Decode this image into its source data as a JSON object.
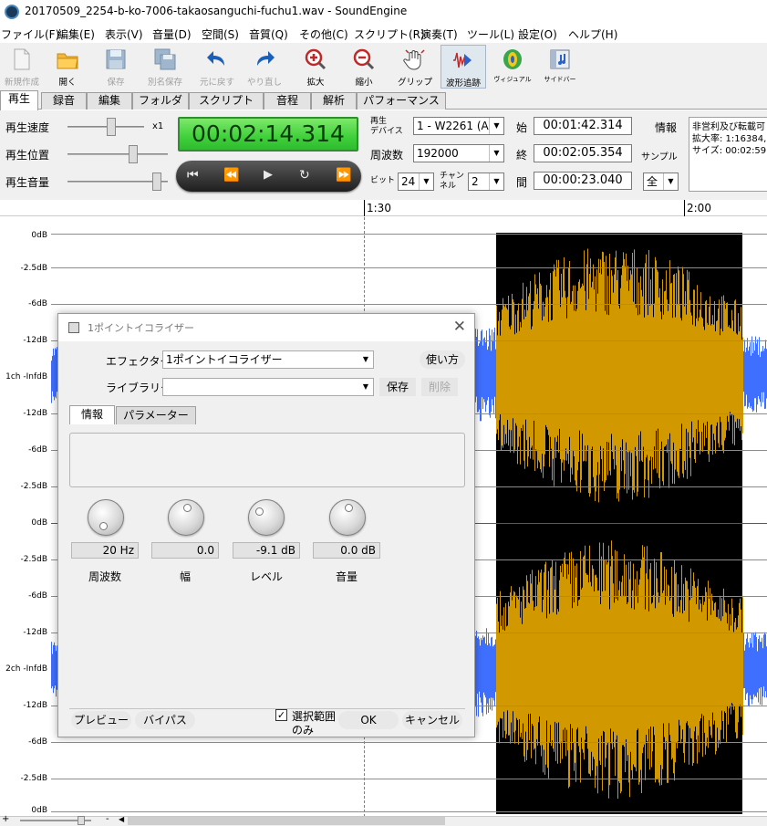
{
  "window": {
    "title": "20170509_2254-b-ko-7006-takaosanguchi-fuchu1.wav - SoundEngine"
  },
  "menu": [
    "ファイル(F)",
    "編集(E)",
    "表示(V)",
    "音量(D)",
    "空間(S)",
    "音質(Q)",
    "その他(C)",
    "スクリプト(R)",
    "演奏(T)",
    "ツール(L)",
    "設定(O)",
    "ヘルプ(H)"
  ],
  "toolbar": [
    {
      "label": "新規作成",
      "icon": "new-file-icon"
    },
    {
      "label": "開く",
      "icon": "folder-icon"
    },
    {
      "label": "保存",
      "icon": "save-icon"
    },
    {
      "label": "別名保存",
      "icon": "save-as-icon"
    },
    {
      "label": "元に戻す",
      "icon": "undo-icon"
    },
    {
      "label": "やり直し",
      "icon": "redo-icon"
    },
    {
      "label": "拡大",
      "icon": "zoom-in-icon"
    },
    {
      "label": "縮小",
      "icon": "zoom-out-icon"
    },
    {
      "label": "グリップ",
      "icon": "grip-hand-icon"
    },
    {
      "label": "波形追跡",
      "icon": "wave-track-icon"
    },
    {
      "label": "ヴィジュアル",
      "icon": "visual-icon"
    },
    {
      "label": "サイドバー",
      "icon": "sidebar-icon"
    }
  ],
  "tabs": [
    "再生",
    "録音",
    "編集",
    "フォルダ",
    "スクリプト",
    "音程",
    "解析",
    "パフォーマンス"
  ],
  "controls": {
    "speed_label": "再生速度",
    "position_label": "再生位置",
    "volume_label": "再生音量",
    "speed_multiplier": "x1",
    "time_display": "00:02:14.314",
    "device_label_1": "再生",
    "device_label_2": "デバイス",
    "device_value": "1 - W2261 (A",
    "freq_label": "周波数",
    "freq_value": "192000",
    "bit_label": "ビット",
    "bit_value": "24",
    "channel_label_1": "チャン",
    "channel_label_2": "ネル",
    "channel_value": "2",
    "start_label": "始",
    "start_value": "00:01:42.314",
    "end_label": "終",
    "end_value": "00:02:05.354",
    "len_label": "間",
    "len_value": "00:00:23.040",
    "info_label": "情報",
    "sample_label": "サンプル",
    "all_value": "全",
    "info_lines": [
      "非営利及び転載可",
      "拡大率: 1:16384,",
      "サイズ: 00:02:59.8"
    ]
  },
  "ruler": {
    "labels": [
      "1:30",
      "2:00"
    ]
  },
  "db_labels": {
    "ch1": [
      "0dB",
      "-2.5dB",
      "-6dB",
      "-12dB",
      "1ch -InfdB",
      "-12dB",
      "-6dB",
      "-2.5dB"
    ],
    "ch2": [
      "0dB",
      "-2.5dB",
      "-6dB",
      "-12dB",
      "2ch -InfdB",
      "-12dB",
      "-6dB",
      "-2.5dB",
      "0dB"
    ]
  },
  "colors": {
    "wave_dim": "#3f6fff",
    "wave_selected": "#d19800",
    "selection_bg": "#000000",
    "lcd_green": "#3fd03a"
  },
  "dialog": {
    "title": "1ポイントイコライザー",
    "effector_label": "エフェクター",
    "effector_value": "1ポイントイコライザー",
    "usage_button": "使い方",
    "library_label": "ライブラリー",
    "library_value": "",
    "save_button": "保存",
    "delete_button": "削除",
    "tab_info": "情報",
    "tab_params": "パラメーター",
    "knobs": [
      {
        "value": "20 Hz",
        "label": "周波数"
      },
      {
        "value": "0.0",
        "label": "幅"
      },
      {
        "value": "-9.1 dB",
        "label": "レベル"
      },
      {
        "value": "0.0 dB",
        "label": "音量"
      }
    ],
    "preview_button": "プレビュー",
    "bypass_button": "バイパス",
    "selection_only_1": "選択範囲",
    "selection_only_2": "のみ",
    "ok_button": "OK",
    "cancel_button": "キャンセル"
  },
  "bottom": {
    "minus": "-",
    "plus": "+"
  }
}
